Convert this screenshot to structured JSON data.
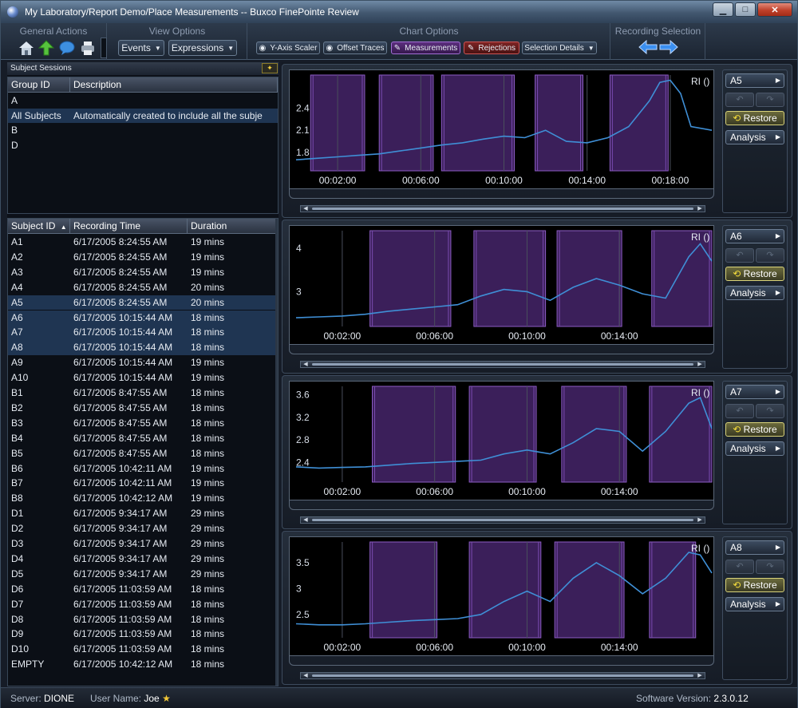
{
  "window": {
    "title": "My Laboratory/Report Demo/Place Measurements -- Buxco FinePointe Review",
    "min_label": "▁",
    "max_label": "□",
    "close_label": "✕"
  },
  "ribbon": {
    "general_actions": {
      "title": "General Actions",
      "icons": [
        "home-icon",
        "upload-arrow-icon",
        "chat-bubble-icon",
        "printer-icon"
      ]
    },
    "view_options": {
      "title": "View Options",
      "events_label": "Events",
      "expressions_label": "Expressions"
    },
    "chart_options": {
      "title": "Chart Options",
      "y_axis_scaler": "Y-Axis Scaler",
      "offset_traces": "Offset Traces",
      "measurements": "Measurements",
      "rejections": "Rejections",
      "selection_details": "Selection Details"
    },
    "recording_selection": {
      "title": "Recording Selection",
      "back_icon": "arrow-left-icon",
      "forward_icon": "arrow-right-icon"
    }
  },
  "sidebar": {
    "panel_title": "Subject Sessions",
    "group_table": {
      "headers": [
        "Group ID",
        "Description"
      ],
      "rows": [
        {
          "id": "A",
          "description": ""
        },
        {
          "id": "All Subjects",
          "description": "Automatically created to include all the subje"
        },
        {
          "id": "B",
          "description": ""
        },
        {
          "id": "D",
          "description": ""
        }
      ],
      "selected_index": 1
    },
    "subject_table": {
      "headers": [
        "Subject ID",
        "Recording Time",
        "Duration"
      ],
      "sort_indicator": "▲",
      "rows": [
        {
          "id": "A1",
          "time": "6/17/2005 8:24:55 AM",
          "duration": "19 mins"
        },
        {
          "id": "A2",
          "time": "6/17/2005 8:24:55 AM",
          "duration": "19 mins"
        },
        {
          "id": "A3",
          "time": "6/17/2005 8:24:55 AM",
          "duration": "19 mins"
        },
        {
          "id": "A4",
          "time": "6/17/2005 8:24:55 AM",
          "duration": "20 mins"
        },
        {
          "id": "A5",
          "time": "6/17/2005 8:24:55 AM",
          "duration": "20 mins"
        },
        {
          "id": "A6",
          "time": "6/17/2005 10:15:44 AM",
          "duration": "18 mins"
        },
        {
          "id": "A7",
          "time": "6/17/2005 10:15:44 AM",
          "duration": "18 mins"
        },
        {
          "id": "A8",
          "time": "6/17/2005 10:15:44 AM",
          "duration": "18 mins"
        },
        {
          "id": "A9",
          "time": "6/17/2005 10:15:44 AM",
          "duration": "19 mins"
        },
        {
          "id": "A10",
          "time": "6/17/2005 10:15:44 AM",
          "duration": "19 mins"
        },
        {
          "id": "B1",
          "time": "6/17/2005 8:47:55 AM",
          "duration": "18 mins"
        },
        {
          "id": "B2",
          "time": "6/17/2005 8:47:55 AM",
          "duration": "18 mins"
        },
        {
          "id": "B3",
          "time": "6/17/2005 8:47:55 AM",
          "duration": "18 mins"
        },
        {
          "id": "B4",
          "time": "6/17/2005 8:47:55 AM",
          "duration": "18 mins"
        },
        {
          "id": "B5",
          "time": "6/17/2005 8:47:55 AM",
          "duration": "18 mins"
        },
        {
          "id": "B6",
          "time": "6/17/2005 10:42:11 AM",
          "duration": "19 mins"
        },
        {
          "id": "B7",
          "time": "6/17/2005 10:42:11 AM",
          "duration": "19 mins"
        },
        {
          "id": "B8",
          "time": "6/17/2005 10:42:12 AM",
          "duration": "19 mins"
        },
        {
          "id": "D1",
          "time": "6/17/2005 9:34:17 AM",
          "duration": "29 mins"
        },
        {
          "id": "D2",
          "time": "6/17/2005 9:34:17 AM",
          "duration": "29 mins"
        },
        {
          "id": "D3",
          "time": "6/17/2005 9:34:17 AM",
          "duration": "29 mins"
        },
        {
          "id": "D4",
          "time": "6/17/2005 9:34:17 AM",
          "duration": "29 mins"
        },
        {
          "id": "D5",
          "time": "6/17/2005 9:34:17 AM",
          "duration": "29 mins"
        },
        {
          "id": "D6",
          "time": "6/17/2005 11:03:59 AM",
          "duration": "18 mins"
        },
        {
          "id": "D7",
          "time": "6/17/2005 11:03:59 AM",
          "duration": "18 mins"
        },
        {
          "id": "D8",
          "time": "6/17/2005 11:03:59 AM",
          "duration": "18 mins"
        },
        {
          "id": "D9",
          "time": "6/17/2005 11:03:59 AM",
          "duration": "18 mins"
        },
        {
          "id": "D10",
          "time": "6/17/2005 11:03:59 AM",
          "duration": "18 mins"
        },
        {
          "id": "EMPTY",
          "time": "6/17/2005 10:42:12 AM",
          "duration": "18 mins"
        }
      ],
      "selected_ids": [
        "A5",
        "A6",
        "A7",
        "A8"
      ]
    }
  },
  "charts": [
    {
      "subject": "A5",
      "restore_label": "Restore",
      "analysis_label": "Analysis",
      "legend": "RI ()"
    },
    {
      "subject": "A6",
      "restore_label": "Restore",
      "analysis_label": "Analysis",
      "legend": "RI ()"
    },
    {
      "subject": "A7",
      "restore_label": "Restore",
      "analysis_label": "Analysis",
      "legend": "RI ()"
    },
    {
      "subject": "A8",
      "restore_label": "Restore",
      "analysis_label": "Analysis",
      "legend": "RI ()"
    }
  ],
  "chart_data": [
    {
      "type": "line",
      "subject": "A5",
      "title": "",
      "series": [
        {
          "name": "RI ()",
          "color": "#3f8fd6",
          "x_minutes": [
            0,
            1,
            2,
            3,
            4,
            5,
            6,
            7,
            8,
            9,
            10,
            11,
            12,
            13,
            14,
            15,
            16,
            17,
            17.5,
            18,
            18.5,
            19,
            20
          ],
          "values": [
            1.7,
            1.72,
            1.74,
            1.76,
            1.78,
            1.82,
            1.86,
            1.9,
            1.93,
            1.98,
            2.02,
            2.0,
            2.1,
            1.95,
            1.93,
            2.0,
            2.15,
            2.5,
            2.75,
            2.78,
            2.6,
            2.15,
            2.1
          ]
        }
      ],
      "x_ticks": [
        "00:02:00",
        "00:06:00",
        "00:10:00",
        "00:14:00",
        "00:18:00"
      ],
      "x_tick_minutes": [
        2,
        6,
        10,
        14,
        18
      ],
      "x_range_minutes": [
        0,
        20
      ],
      "y_ticks": [
        1.8,
        2.1,
        2.4
      ],
      "y_range": [
        1.55,
        2.85
      ],
      "highlight_regions_minutes": [
        [
          0.7,
          3.3
        ],
        [
          4.0,
          6.6
        ],
        [
          7.0,
          10.5
        ],
        [
          11.5,
          13.8
        ],
        [
          15.1,
          17.9
        ]
      ],
      "xlabel": "",
      "ylabel": ""
    },
    {
      "type": "line",
      "subject": "A6",
      "title": "",
      "series": [
        {
          "name": "RI ()",
          "color": "#3f8fd6",
          "x_minutes": [
            0,
            1,
            2,
            3,
            4,
            5,
            6,
            7,
            8,
            9,
            10,
            11,
            12,
            13,
            14,
            15,
            16,
            17,
            17.5,
            18
          ],
          "values": [
            2.4,
            2.42,
            2.44,
            2.48,
            2.55,
            2.6,
            2.65,
            2.7,
            2.9,
            3.05,
            3.0,
            2.8,
            3.1,
            3.3,
            3.15,
            2.95,
            2.85,
            3.8,
            4.1,
            3.7
          ]
        }
      ],
      "x_ticks": [
        "00:02:00",
        "00:06:00",
        "00:10:00",
        "00:14:00"
      ],
      "x_tick_minutes": [
        2,
        6,
        10,
        14
      ],
      "x_range_minutes": [
        0,
        18
      ],
      "y_ticks": [
        3,
        4
      ],
      "y_range": [
        2.2,
        4.4
      ],
      "highlight_regions_minutes": [
        [
          3.2,
          6.7
        ],
        [
          7.7,
          10.8
        ],
        [
          11.3,
          14.1
        ],
        [
          15.4,
          18
        ]
      ],
      "xlabel": "",
      "ylabel": ""
    },
    {
      "type": "line",
      "subject": "A7",
      "title": "",
      "series": [
        {
          "name": "RI ()",
          "color": "#3f8fd6",
          "x_minutes": [
            0,
            1,
            2,
            3,
            4,
            5,
            6,
            7,
            8,
            9,
            10,
            11,
            12,
            13,
            14,
            15,
            16,
            17,
            17.5,
            18
          ],
          "values": [
            2.32,
            2.3,
            2.31,
            2.32,
            2.35,
            2.38,
            2.4,
            2.42,
            2.44,
            2.55,
            2.62,
            2.55,
            2.75,
            3.0,
            2.95,
            2.6,
            2.95,
            3.45,
            3.55,
            3.0
          ]
        }
      ],
      "x_ticks": [
        "00:02:00",
        "00:06:00",
        "00:10:00",
        "00:14:00"
      ],
      "x_tick_minutes": [
        2,
        6,
        10,
        14
      ],
      "x_range_minutes": [
        0,
        18
      ],
      "y_ticks": [
        2.4,
        2.8,
        3.2,
        3.6
      ],
      "y_range": [
        2.05,
        3.75
      ],
      "highlight_regions_minutes": [
        [
          3.3,
          6.9
        ],
        [
          7.5,
          10.4
        ],
        [
          11.5,
          14.3
        ],
        [
          15.3,
          18
        ]
      ],
      "xlabel": "",
      "ylabel": ""
    },
    {
      "type": "line",
      "subject": "A8",
      "title": "",
      "series": [
        {
          "name": "RI ()",
          "color": "#3f8fd6",
          "x_minutes": [
            0,
            1,
            2,
            3,
            4,
            5,
            6,
            7,
            8,
            9,
            10,
            11,
            12,
            13,
            14,
            15,
            16,
            17,
            17.5,
            18
          ],
          "values": [
            2.32,
            2.3,
            2.3,
            2.32,
            2.35,
            2.38,
            2.4,
            2.42,
            2.5,
            2.75,
            2.95,
            2.75,
            3.2,
            3.5,
            3.25,
            2.9,
            3.2,
            3.7,
            3.65,
            3.3
          ]
        }
      ],
      "x_ticks": [
        "00:02:00",
        "00:06:00",
        "00:10:00",
        "00:14:00"
      ],
      "x_tick_minutes": [
        2,
        6,
        10,
        14
      ],
      "x_range_minutes": [
        0,
        18
      ],
      "y_ticks": [
        2.5,
        3,
        3.5
      ],
      "y_range": [
        2.05,
        3.9
      ],
      "highlight_regions_minutes": [
        [
          3.2,
          6.1
        ],
        [
          7.5,
          10.6
        ],
        [
          11.2,
          14.2
        ],
        [
          15.3,
          17.3
        ]
      ],
      "xlabel": "",
      "ylabel": ""
    }
  ],
  "status": {
    "server_label": "Server:",
    "server_value": "DIONE",
    "user_label": "User Name:",
    "user_value": "Joe",
    "version_label": "Software Version:",
    "version_value": "2.3.0.12"
  }
}
